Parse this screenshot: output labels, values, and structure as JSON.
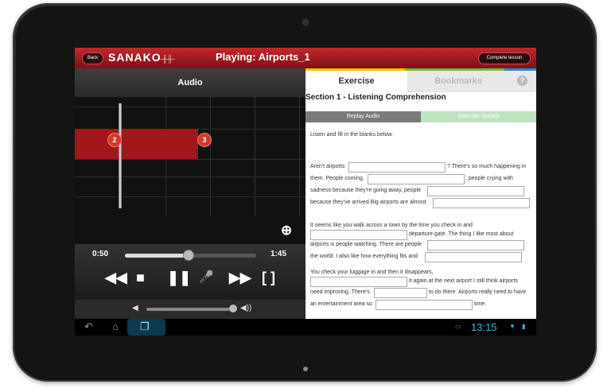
{
  "topbar": {
    "back_label": "Back",
    "logo_text": "SANAKO",
    "title": "Playing: Airports_1",
    "complete_label": "Complete lesson"
  },
  "audio": {
    "header": "Audio",
    "marker_2": "2",
    "marker_3": "3",
    "time_current": "0:50",
    "time_total": "1:45",
    "progress": 0.48,
    "volume": 0.92
  },
  "tabs": {
    "exercise": "Exercise",
    "bookmarks": "Bookmarks",
    "help": "?"
  },
  "exercise": {
    "section_title": "Section 1 - Listening Comprehension",
    "replay_label": "Replay Audio",
    "started_label": "Exercise Started",
    "instructions": "Listen and fill in the blanks below.",
    "p1_l1a": "Aren't airports",
    "p1_l1b": "? There's so much happening in",
    "p1_l2a": "them. People coming,",
    "p1_l2b": "; people crying with",
    "p1_l3a": "sadness because they're going away, people",
    "p1_l4a": "because they've arrived.Big airports are almost",
    "p2_l1": "It seems like you walk across a town by the time you check in and",
    "p2_l2b": "departure gate. The thing I like most about",
    "p2_l3a": "airports is people watching. There are people",
    "p2_l4a": "the world. I also like how everything fits and",
    "p3_l1": "You check your luggage in and then it disappears,",
    "p3_l2b": "it again at the next airport.I still think airports",
    "p3_l3a": "need improving. There's",
    "p3_l3b": "to do there. Airports really need to have",
    "p3_l4a": "an entertainment area so",
    "p3_l4b": "time."
  },
  "status": {
    "clock": "13:15"
  },
  "colors": {
    "brand_red": "#a3161b",
    "tab_yellow": "#f2c200",
    "tab_green": "#6cbf3a",
    "tab_blue": "#2a8ad6",
    "clock_blue": "#39b5e0"
  },
  "icons": {
    "rewind": "rewind-icon",
    "stop": "stop-icon",
    "pause": "pause-icon",
    "record": "microphone-icon",
    "forward": "fast-forward-icon",
    "loop": "loop-brackets-icon",
    "zoom": "zoom-in-icon",
    "volume_low": "volume-low-icon",
    "volume_high": "volume-high-icon"
  }
}
